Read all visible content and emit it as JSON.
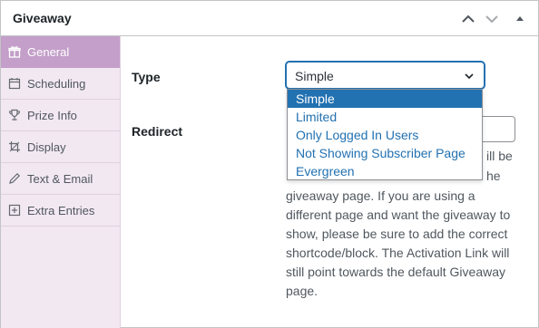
{
  "header": {
    "title": "Giveaway",
    "move_up_icon": "chevron-up-icon",
    "move_down_icon": "chevron-down-icon",
    "toggle_icon": "triangle-up-icon"
  },
  "sidebar": {
    "items": [
      {
        "label": "General",
        "icon": "gift-icon",
        "active": true
      },
      {
        "label": "Scheduling",
        "icon": "calendar-icon",
        "active": false
      },
      {
        "label": "Prize Info",
        "icon": "trophy-icon",
        "active": false
      },
      {
        "label": "Display",
        "icon": "crop-icon",
        "active": false
      },
      {
        "label": "Text & Email",
        "icon": "pencil-icon",
        "active": false
      },
      {
        "label": "Extra Entries",
        "icon": "plus-square-icon",
        "active": false
      }
    ]
  },
  "fields": {
    "type_label": "Type",
    "redirect_label": "Redirect"
  },
  "type_select": {
    "value": "Simple",
    "options": [
      "Simple",
      "Limited",
      "Only Logged In Users",
      "Not Showing Subscriber Page",
      "Evergreen"
    ]
  },
  "help": {
    "fragment_1": "ill be",
    "fragment_2": "he",
    "lines": [
      "giveaway page. If you are using a",
      "different page and want the giveaway to",
      "show, please be sure to add the correct",
      "shortcode/block. The Activation Link will",
      "still point towards the default Giveaway",
      "page."
    ]
  },
  "colors": {
    "accent": "#2271b1",
    "sidebar_bg": "#f2e8f2",
    "sidebar_active": "#c39fc9"
  }
}
